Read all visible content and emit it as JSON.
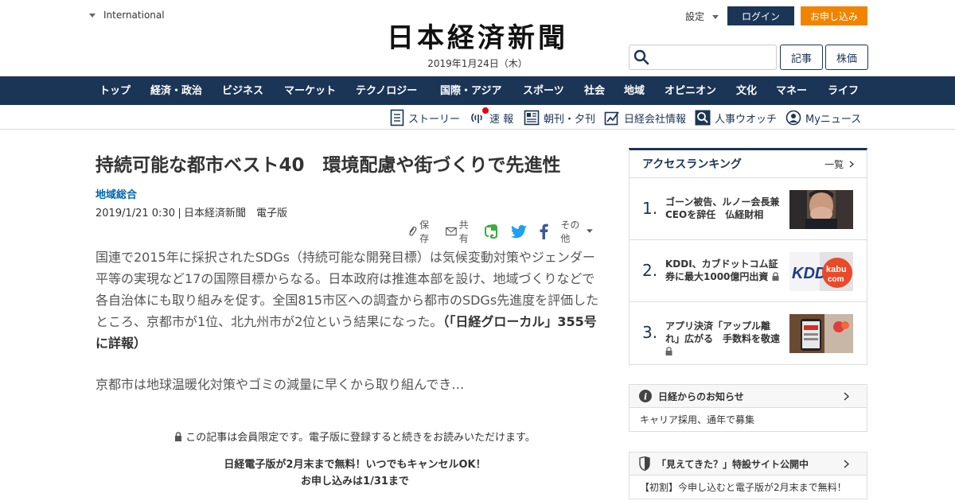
{
  "header": {
    "region": "International",
    "logo": "日本経済新聞",
    "date": "2019年1月24日（木）",
    "settings": "設定",
    "login": "ログイン",
    "apply": "お申し込み",
    "search_placeholder": "",
    "kiji": "記事",
    "kabuka": "株価",
    "colors": {
      "navy": "#1b3556",
      "orange": "#f08400"
    }
  },
  "nav": [
    "トップ",
    "経済・政治",
    "ビジネス",
    "マーケット",
    "テクノロジー",
    "国際・アジア",
    "スポーツ",
    "社会",
    "地域",
    "オピニオン",
    "文化",
    "マネー",
    "ライフ"
  ],
  "subnav": [
    "ストーリー",
    "速 報",
    "朝刊・夕刊",
    "日経会社情報",
    "人事ウオッチ",
    "Myニュース"
  ],
  "article": {
    "headline": "持続可能な都市ベスト40　環境配慮や街づくりで先進性",
    "category": "地域総合",
    "datetime": "2019/1/21 0:30",
    "source": "日本経済新聞　電子版",
    "share": {
      "save": "保存",
      "share": "共有",
      "other": "その他"
    },
    "body1_lines": [
      "国連で2015年に採択されたSDGs（持続可能な開発目標）は気候変動対策やジェンダー",
      "平等の実現など17の国際目標からなる。日本政府は推進本部を設け、地域づくりなどで",
      "各自治体にも取り組みを促す。全国815市区への調査から都市のSDGs先進度を評価した"
    ],
    "body1_last": "ところ、京都市が1位、北九州市が2位という結果になった。",
    "body1_bold": "（「日経グローカル」355号",
    "body1_bold2": "に詳報）",
    "body2": "京都市は地球温暖化対策やゴミの減量に早くから取り組んでき…",
    "locked": "この記事は会員限定です。電子版に登録すると続きをお読みいただけます。",
    "promo1": "日経電子版が2月末まで無料！いつでもキャンセルOK！",
    "promo2": "お申し込みは1/31まで"
  },
  "ranking": {
    "title": "アクセスランキング",
    "more": "一覧",
    "items": [
      {
        "num": "1.",
        "title": "ゴーン被告、ルノー会長兼CEOを辞任　仏経財相",
        "locked": false
      },
      {
        "num": "2.",
        "title": "KDDI、カブドットコム証券に最大1000億円出資",
        "locked": true
      },
      {
        "num": "3.",
        "title": "アプリ決済「アップル離れ」広がる　手数料を敬遠",
        "locked": true
      }
    ]
  },
  "notices": [
    {
      "head": "日経からのお知らせ",
      "body": "キャリア採用、通年で募集"
    },
    {
      "head": "「見えてきた？」特設サイト公開中",
      "body": "【初割】今申し込むと電子版が2月末まで無料！"
    }
  ]
}
